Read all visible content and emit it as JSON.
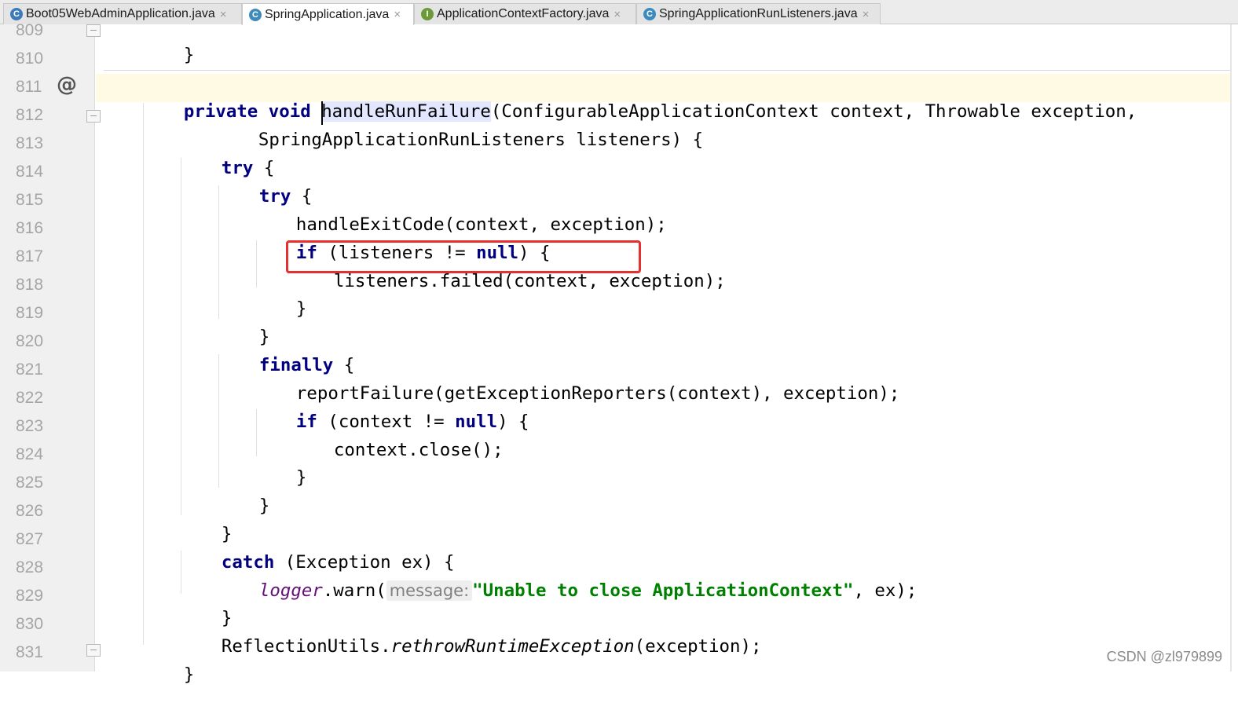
{
  "tabs": [
    {
      "label": "Boot05WebAdminApplication.java",
      "icon": "class-icon",
      "icon_letter": "C",
      "icon_color": "#3d7ab8",
      "active": false
    },
    {
      "label": "SpringApplication.java",
      "icon": "class-icon",
      "icon_letter": "C",
      "icon_color": "#3d8bbd",
      "active": true
    },
    {
      "label": "ApplicationContextFactory.java",
      "icon": "interface-icon",
      "icon_letter": "I",
      "icon_color": "#6a9a3a",
      "active": false
    },
    {
      "label": "SpringApplicationRunListeners.java",
      "icon": "class-icon",
      "icon_letter": "C",
      "icon_color": "#3d8bbd",
      "active": false
    }
  ],
  "tab_close_glyph": "×",
  "gutter": {
    "line_numbers": [
      "809",
      "810",
      "811",
      "812",
      "813",
      "814",
      "815",
      "816",
      "817",
      "818",
      "819",
      "820",
      "821",
      "822",
      "823",
      "824",
      "825",
      "826",
      "827",
      "828",
      "829",
      "830",
      "831"
    ],
    "override_marker": "@"
  },
  "code": {
    "l809": "}",
    "l811_kw1": "private",
    "l811_kw2": "void",
    "l811_method": "handleRunFailure",
    "l811_rest": "(ConfigurableApplicationContext context, Throwable exception,",
    "l812": "SpringApplicationRunListeners listeners) {",
    "l813_kw": "try",
    "l813_rest": " {",
    "l814_kw": "try",
    "l814_rest": " {",
    "l815": "handleExitCode(context, exception);",
    "l816_kw": "if",
    "l816_mid": " (listeners != ",
    "l816_null": "null",
    "l816_end": ") {",
    "l817": "listeners.failed(context, exception);",
    "l818": "}",
    "l819": "}",
    "l820_kw": "finally",
    "l820_rest": " {",
    "l821": "reportFailure(getExceptionReporters(context), exception);",
    "l822_kw": "if",
    "l822_mid": " (context != ",
    "l822_null": "null",
    "l822_end": ") {",
    "l823": "context.close();",
    "l824": "}",
    "l825": "}",
    "l826": "}",
    "l827_kw": "catch",
    "l827_rest": " (Exception ex) {",
    "l828_field": "logger",
    "l828_call": ".warn(",
    "l828_hint": "message:",
    "l828_str": "\"Unable to close ApplicationContext\"",
    "l828_end": ", ex);",
    "l829": "}",
    "l830_cls": "ReflectionUtils.",
    "l830_method": "rethrowRuntimeException",
    "l830_end": "(exception);",
    "l831": "}"
  },
  "highlight_box_color": "#e53030",
  "watermark": "CSDN @zl979899"
}
